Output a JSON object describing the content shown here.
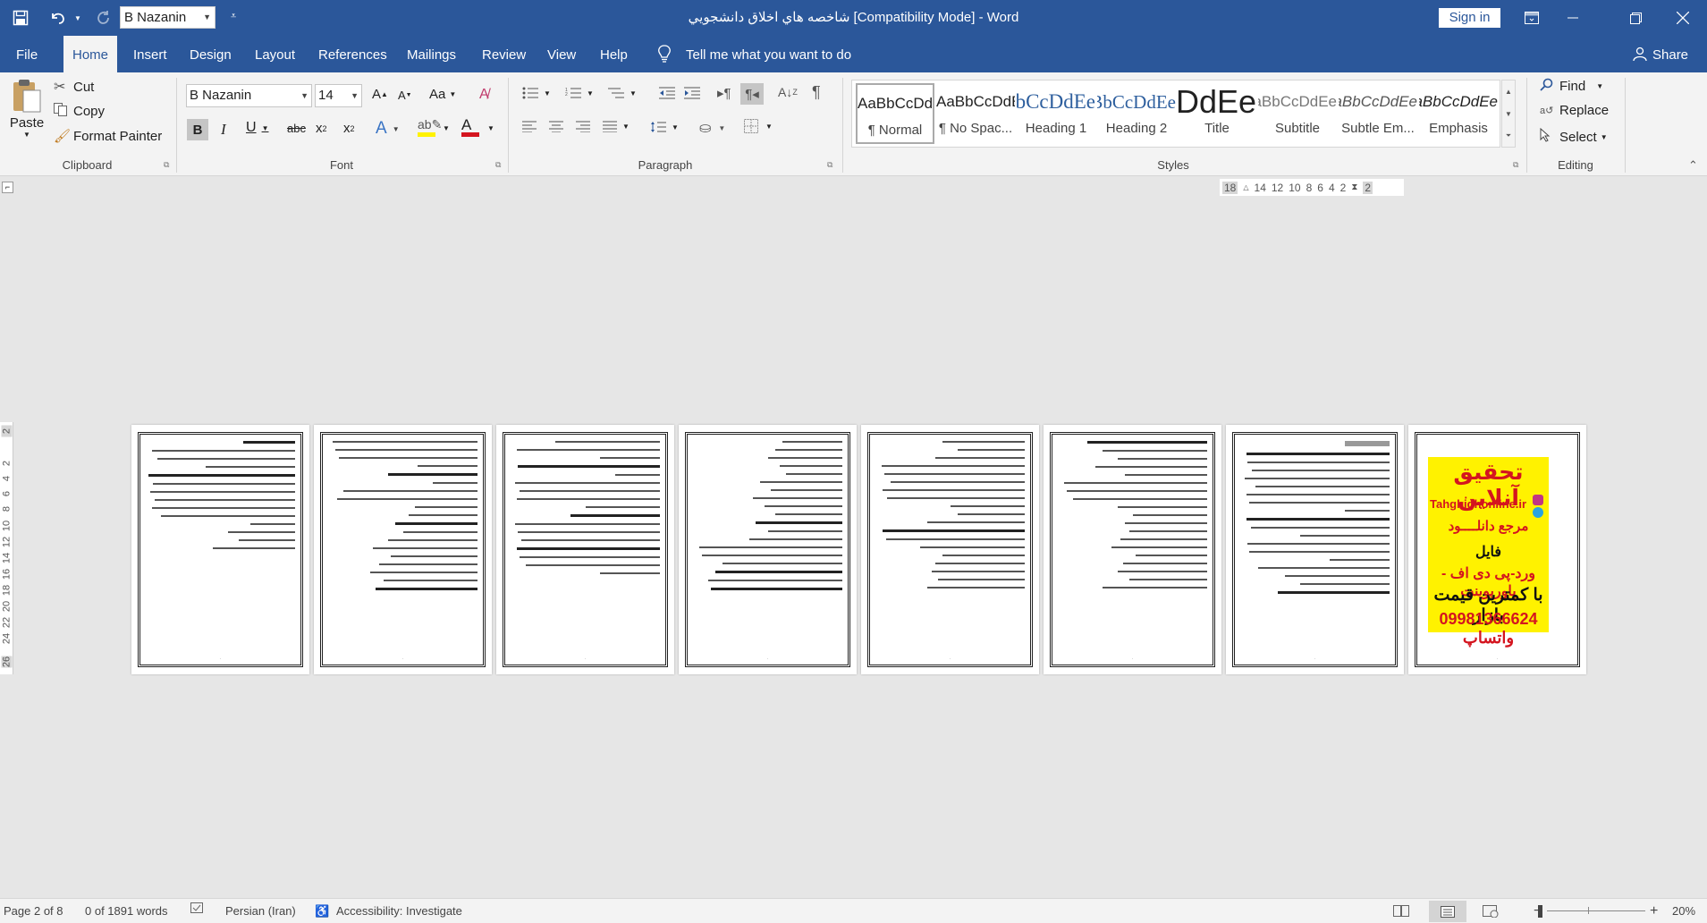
{
  "titlebar": {
    "title": "شاخصه هاي اخلاق دانشجويي [Compatibility Mode]  -  Word",
    "font_qat": "B Nazanin",
    "sign_in": "Sign in"
  },
  "tabs": [
    "File",
    "Home",
    "Insert",
    "Design",
    "Layout",
    "References",
    "Mailings",
    "Review",
    "View",
    "Help"
  ],
  "tell_me": "Tell me what you want to do",
  "share": "Share",
  "clipboard": {
    "paste": "Paste",
    "cut": "Cut",
    "copy": "Copy",
    "format_painter": "Format Painter",
    "label": "Clipboard"
  },
  "font": {
    "name": "B Nazanin",
    "size": "14",
    "label": "Font",
    "case": "Aa"
  },
  "paragraph": {
    "label": "Paragraph"
  },
  "styles": {
    "label": "Styles",
    "items": [
      {
        "preview": "AaBbCcDdEe",
        "name": "¶ Normal"
      },
      {
        "preview": "AaBbCcDdEe",
        "name": "¶ No Spac..."
      },
      {
        "preview": "AaBbCcDdEe",
        "name": "Heading 1"
      },
      {
        "preview": "AaBbCcDdEe",
        "name": "Heading 2"
      },
      {
        "preview": "AaBbCcDdEe",
        "name": "Title"
      },
      {
        "preview": "AaBbCcDdEe",
        "name": "Subtitle"
      },
      {
        "preview": "AaBbCcDdEe",
        "name": "Subtle Em..."
      },
      {
        "preview": "AaBbCcDdEe",
        "name": "Emphasis"
      }
    ]
  },
  "editing": {
    "find": "Find",
    "replace": "Replace",
    "select": "Select",
    "label": "Editing"
  },
  "ruler": [
    "18",
    "14",
    "12",
    "10",
    "8",
    "6",
    "4",
    "2",
    "2"
  ],
  "vruler": [
    "2",
    "2",
    "4",
    "6",
    "8",
    "10",
    "12",
    "14",
    "16",
    "18",
    "20",
    "22",
    "24",
    "26"
  ],
  "ad": {
    "line1": "تحقیق آنلاین",
    "line2": "Tahghighonline.ir",
    "line3": "مرجع دانلــــود",
    "line4": "فایل",
    "line5": "ورد-پی دی اف - پاورپوینت",
    "line6": "با کمترین قیمت بازار",
    "line7": "09981366624 واتساپ"
  },
  "status": {
    "page": "Page 2 of 8",
    "words": "0 of 1891 words",
    "language": "Persian (Iran)",
    "accessibility": "Accessibility: Investigate",
    "zoom": "20%"
  },
  "colors": {
    "brand": "#2b579a",
    "ribbon": "#f3f3f3",
    "canvas": "#e6e6e6",
    "highlight": "#fff200",
    "font_color": "#d4151f"
  }
}
